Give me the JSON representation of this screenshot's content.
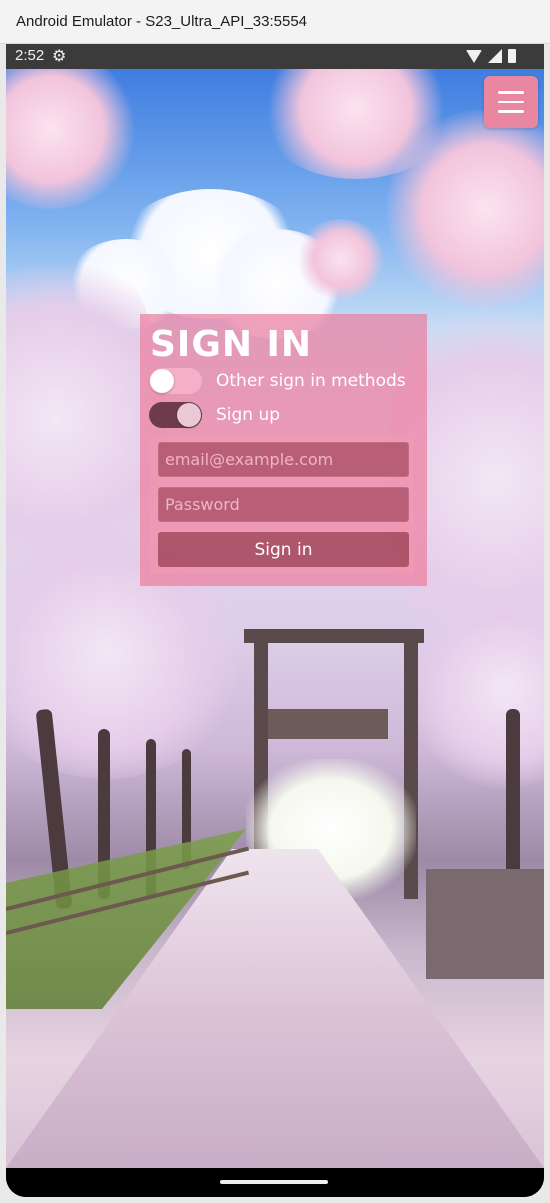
{
  "window": {
    "title": "Android Emulator - S23_Ultra_API_33:5554"
  },
  "status_bar": {
    "time": "2:52",
    "icons": [
      "settings-gear-icon",
      "wifi-icon",
      "cell-signal-icon",
      "battery-icon"
    ]
  },
  "menu": {
    "icon": "hamburger-menu-icon",
    "color": "#e8879f"
  },
  "signin": {
    "title": "SIGN IN",
    "toggles": [
      {
        "label": "Other sign in methods",
        "state": "off"
      },
      {
        "label": "Sign up",
        "state": "on"
      }
    ],
    "email_placeholder": "email@example.com",
    "password_placeholder": "Password",
    "button_label": "Sign in",
    "card_color": "#ec80a0",
    "button_color": "#96303c"
  }
}
